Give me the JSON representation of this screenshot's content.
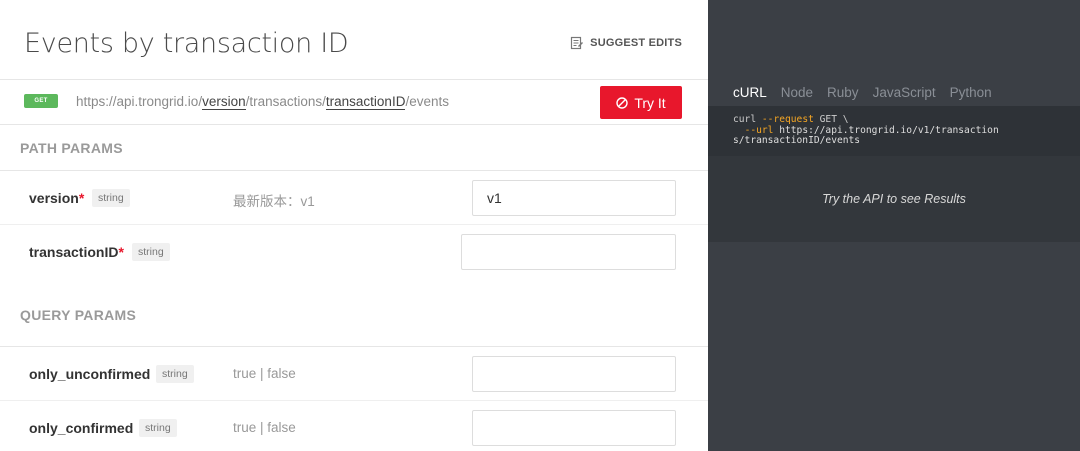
{
  "page": {
    "title": "Events by transaction ID",
    "suggest_edits": "SUGGEST EDITS"
  },
  "endpoint": {
    "method": "GET",
    "base": "https://api.trongrid.io/",
    "seg_version": "version",
    "mid": "/transactions/",
    "seg_txid": "transactionID",
    "tail": "/events",
    "try_label": "Try It"
  },
  "path_params": {
    "title": "PATH PARAMS",
    "params": [
      {
        "name": "version",
        "required": "*",
        "type": "string",
        "desc": "最新版本：v1",
        "value": "v1"
      },
      {
        "name": "transactionID",
        "required": "*",
        "type": "string",
        "desc": "",
        "value": ""
      }
    ]
  },
  "query_params": {
    "title": "QUERY PARAMS",
    "params": [
      {
        "name": "only_unconfirmed",
        "type": "string",
        "desc": "true | false",
        "value": ""
      },
      {
        "name": "only_confirmed",
        "type": "string",
        "desc": "true | false",
        "value": ""
      }
    ]
  },
  "code_panel": {
    "tabs": [
      "cURL",
      "Node",
      "Ruby",
      "JavaScript",
      "Python"
    ],
    "active_tab": "cURL",
    "line1_cmd": "curl ",
    "line1_flag": "--request",
    "line1_rest": " GET \\",
    "line2_flag": "--url",
    "line2_rest": " https://api.trongrid.io/v1/transaction",
    "line3": "s/transactionID/events",
    "results_text": "Try the API to see Results"
  },
  "colors": {
    "accent_red": "#e8172c",
    "get_green": "#5cb85c",
    "panel_dark": "#3b3f45"
  }
}
